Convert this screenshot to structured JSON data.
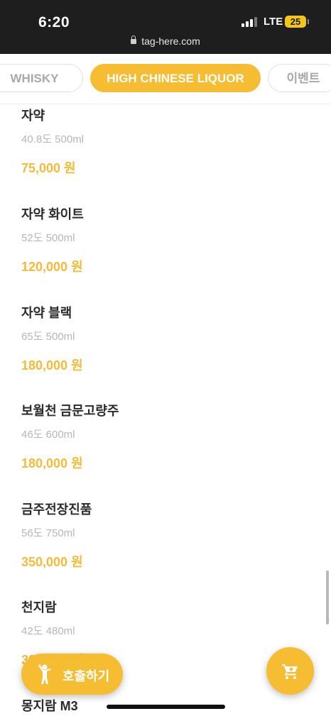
{
  "status_bar": {
    "time": "6:20",
    "url": "tag-here.com",
    "network": "LTE",
    "battery": "25"
  },
  "tabs": [
    {
      "label": "WHISKY",
      "active": false
    },
    {
      "label": "HIGH CHINESE LIQUOR",
      "active": true
    },
    {
      "label": "이벤트",
      "active": false
    }
  ],
  "menu": {
    "items": [
      {
        "name": "자약",
        "desc": "40.8도 500ml",
        "price": "75,000 원"
      },
      {
        "name": "자약 화이트",
        "desc": "52도 500ml",
        "price": "120,000 원"
      },
      {
        "name": "자약 블랙",
        "desc": "65도 500ml",
        "price": "180,000 원"
      },
      {
        "name": "보월천 금문고량주",
        "desc": "46도 600ml",
        "price": "180,000 원"
      },
      {
        "name": "금주전장진품",
        "desc": "56도 750ml",
        "price": "350,000 원"
      },
      {
        "name": "천지람",
        "desc": "42도 480ml",
        "price": "300,000 원"
      },
      {
        "name": "몽지람 M3",
        "desc": "",
        "price": ""
      }
    ]
  },
  "call_button": {
    "label": "호출하기"
  },
  "icons": {
    "call": "person-waving-icon",
    "cart": "cart-icon",
    "lock": "lock-icon"
  },
  "colors": {
    "accent": "#f6bd33",
    "price": "#f3bb37"
  }
}
